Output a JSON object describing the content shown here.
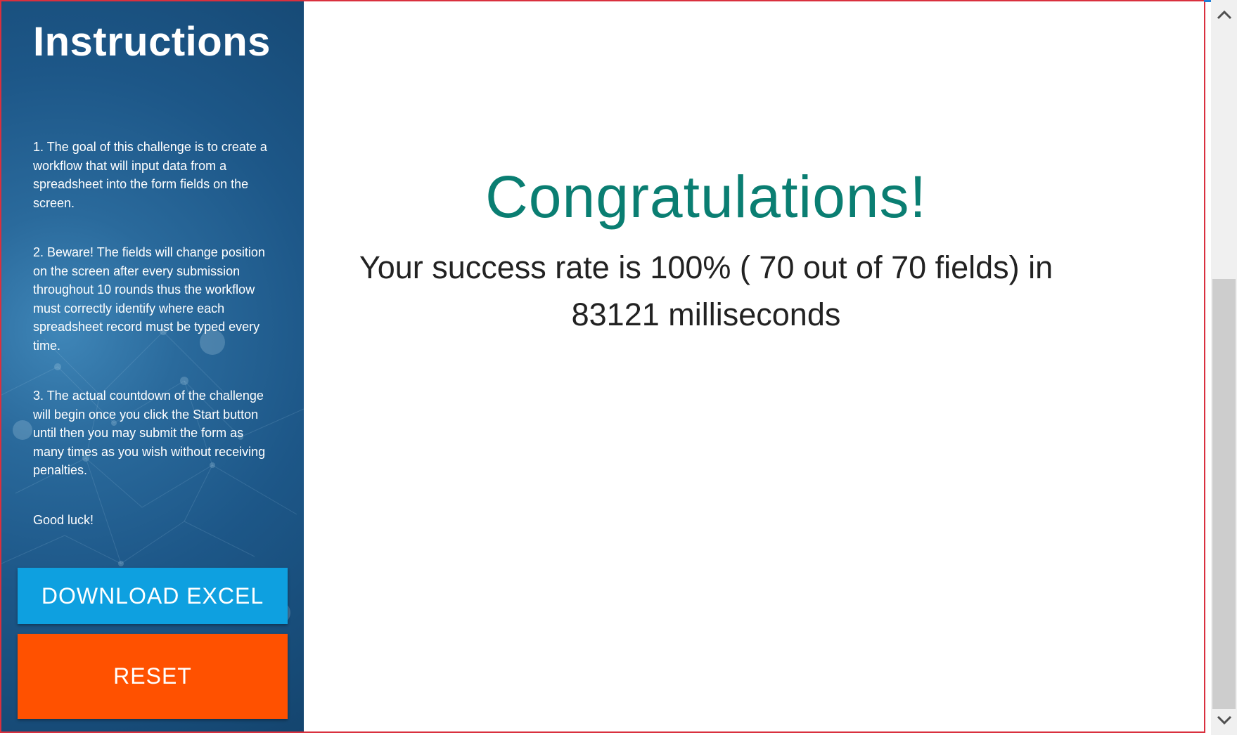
{
  "sidebar": {
    "title": "Instructions",
    "instructions": [
      "1. The goal of this challenge is to create a workflow that will input data from a spreadsheet into the form fields on the screen.",
      "2. Beware! The fields will change position on the screen after every submission throughout 10 rounds thus the workflow must correctly identify where each spreadsheet record must be typed every time.",
      "3. The actual countdown of the challenge will begin once you click the Start button until then you may submit the form as many times as you wish without receiving penalties.",
      "Good luck!"
    ],
    "download_label": "DOWNLOAD EXCEL",
    "reset_label": "RESET"
  },
  "main": {
    "congrats": "Congratulations!",
    "result_line1": "Your success rate is 100% ( 70 out of 70 fields) in",
    "result_line2": "83121 milliseconds"
  },
  "scrollbar": {
    "up_icon": "chevron-up-icon",
    "down_icon": "chevron-down-icon"
  },
  "colors": {
    "sidebar": "#1d5788",
    "download_button": "#0ea0e0",
    "reset_button": "#ff5100",
    "congrats_text": "#0a7e72",
    "frame_border": "#d9303e"
  }
}
